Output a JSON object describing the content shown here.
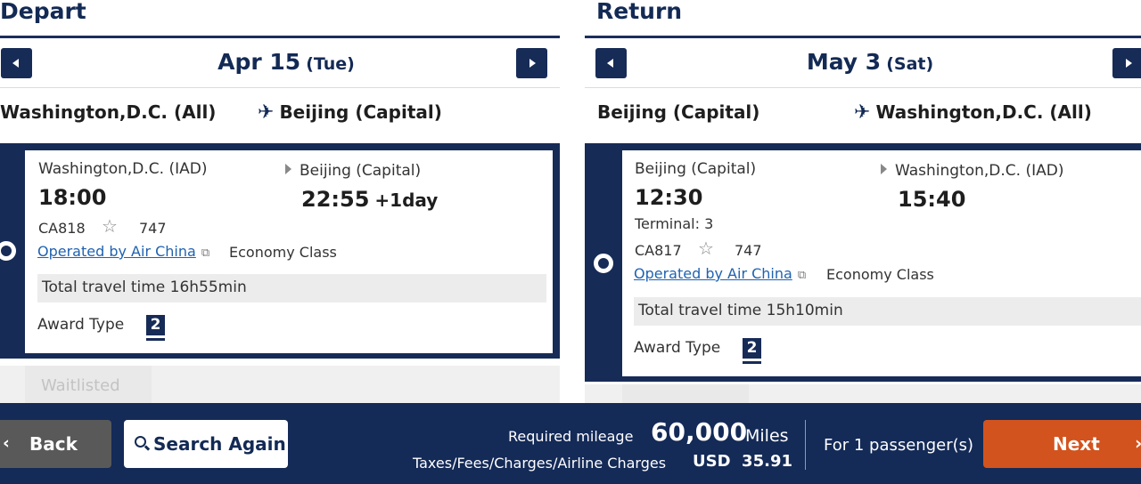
{
  "depart": {
    "heading": "Depart",
    "date_md": "Apr 15",
    "date_dow": "(Tue)",
    "route_from": "Washington,D.C. (All)",
    "route_to": "Beijing (Capital)",
    "flight": {
      "origin": "Washington,D.C. (IAD)",
      "dep_time": "18:00",
      "destination": "Beijing (Capital)",
      "arr_time": "22:55",
      "day_offset": "+1day",
      "flight_number": "CA818",
      "aircraft": "747",
      "operated_by": "Operated by Air China",
      "cabin": "Economy Class",
      "total_travel": "Total travel time 16h55min",
      "award_type_label": "Award Type",
      "award_type_value": "2"
    },
    "next_option_status": "Waitlisted"
  },
  "return": {
    "heading": "Return",
    "date_md": "May 3",
    "date_dow": "(Sat)",
    "route_from": "Beijing (Capital)",
    "route_to": "Washington,D.C. (All)",
    "flight": {
      "origin": "Beijing (Capital)",
      "dep_time": "12:30",
      "terminal": "Terminal: 3",
      "destination": "Washington,D.C. (IAD)",
      "arr_time": "15:40",
      "flight_number": "CA817",
      "aircraft": "747",
      "operated_by": "Operated by Air China",
      "cabin": "Economy Class",
      "total_travel": "Total travel time 15h10min",
      "award_type_label": "Award Type",
      "award_type_value": "2"
    }
  },
  "footer": {
    "back_label": "Back",
    "search_again_label": "Search Again",
    "required_mileage_label": "Required mileage",
    "required_mileage_value": "60,000",
    "required_mileage_unit": "Miles",
    "taxes_label": "Taxes/Fees/Charges/Airline Charges",
    "taxes_value": "USD  35.91",
    "passengers": "For 1 passenger(s)",
    "next_label": "Next"
  },
  "colors": {
    "navy": "#172b57",
    "next_orange": "#d2531e",
    "back_gray": "#595959",
    "link_blue": "#1f62b0"
  },
  "icons": [
    "previous-date-icon",
    "next-date-icon",
    "airplane-icon",
    "star-alliance-icon",
    "external-link-icon",
    "search-icon",
    "chevron-left-icon",
    "chevron-right-icon",
    "radio-selected-icon"
  ]
}
